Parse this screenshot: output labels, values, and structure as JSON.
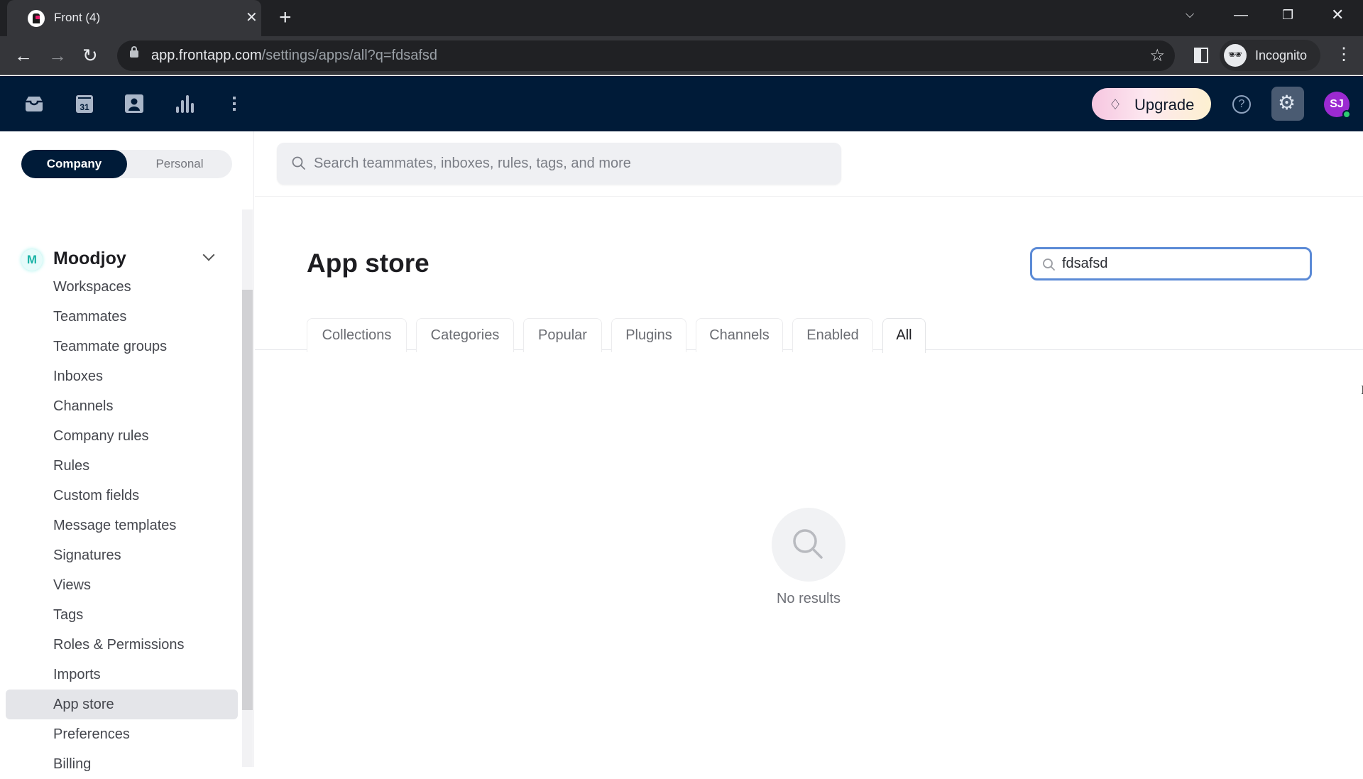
{
  "browser": {
    "tab_title": "Front (4)",
    "new_tab_icon": "plus-icon",
    "url_host": "app.frontapp.com",
    "url_path": "/settings/apps/all?q=fdsafsd",
    "profile_label": "Incognito",
    "window_controls": [
      "chevron-down-icon",
      "minimize-icon",
      "restore-icon",
      "close-icon"
    ]
  },
  "appbar": {
    "nav_icons": [
      "inbox-icon",
      "calendar-icon",
      "contacts-icon",
      "analytics-icon",
      "more-vertical-icon"
    ],
    "calendar_day": "31",
    "upgrade_label": "Upgrade",
    "avatar_initials": "SJ",
    "colors": {
      "background": "#001b38",
      "avatar": "#9b2ad1",
      "presence": "#2ecc71"
    }
  },
  "sidebar": {
    "scope_tabs": [
      {
        "label": "Company",
        "active": true
      },
      {
        "label": "Personal",
        "active": false
      }
    ],
    "org": {
      "badge": "M",
      "name": "Moodjoy"
    },
    "items": [
      {
        "label": "Workspaces"
      },
      {
        "label": "Teammates"
      },
      {
        "label": "Teammate groups"
      },
      {
        "label": "Inboxes"
      },
      {
        "label": "Channels"
      },
      {
        "label": "Company rules"
      },
      {
        "label": "Rules"
      },
      {
        "label": "Custom fields"
      },
      {
        "label": "Message templates"
      },
      {
        "label": "Signatures"
      },
      {
        "label": "Views"
      },
      {
        "label": "Tags"
      },
      {
        "label": "Roles & Permissions"
      },
      {
        "label": "Imports"
      },
      {
        "label": "App store",
        "active": true
      },
      {
        "label": "Preferences"
      },
      {
        "label": "Billing"
      }
    ]
  },
  "main": {
    "global_search_placeholder": "Search teammates, inboxes, rules, tags, and more",
    "title": "App store",
    "app_search_value": "fdsafsd",
    "tabs": [
      {
        "label": "Collections"
      },
      {
        "label": "Categories"
      },
      {
        "label": "Popular"
      },
      {
        "label": "Plugins"
      },
      {
        "label": "Channels"
      },
      {
        "label": "Enabled"
      },
      {
        "label": "All",
        "active": true
      }
    ],
    "empty_state": "No results",
    "accent_color": "#5b8ad6"
  }
}
